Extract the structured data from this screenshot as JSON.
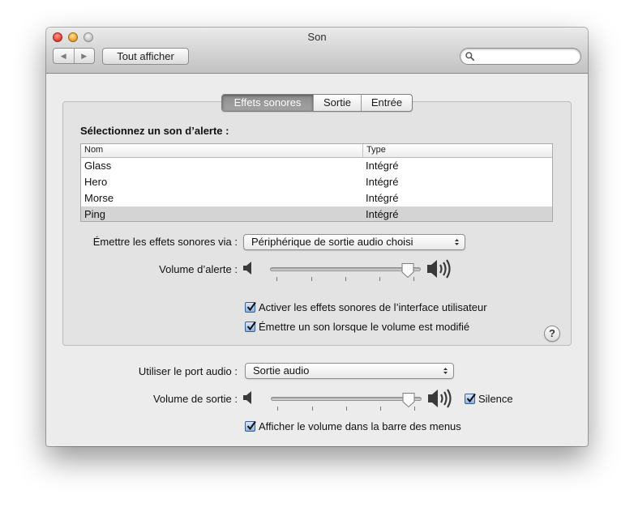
{
  "window": {
    "title": "Son"
  },
  "toolbar": {
    "back_label": "◀",
    "forward_label": "▶",
    "show_all_label": "Tout afficher",
    "search_value": "",
    "search_placeholder": ""
  },
  "tabs": [
    {
      "label": "Effets sonores",
      "selected": true
    },
    {
      "label": "Sortie",
      "selected": false
    },
    {
      "label": "Entrée",
      "selected": false
    }
  ],
  "alerts": {
    "heading": "Sélectionnez un son d’alerte :",
    "columns": [
      "Nom",
      "Type"
    ],
    "rows": [
      {
        "name": "Glass",
        "type": "Intégré",
        "selected": false
      },
      {
        "name": "Hero",
        "type": "Intégré",
        "selected": false
      },
      {
        "name": "Morse",
        "type": "Intégré",
        "selected": false
      },
      {
        "name": "Ping",
        "type": "Intégré",
        "selected": true
      }
    ]
  },
  "effects": {
    "play_via_label": "Émettre les effets sonores via :",
    "play_via_value": "Périphérique de sortie audio choisi",
    "alert_volume_label": "Volume d’alerte :",
    "alert_volume_level": 0.96,
    "ui_effects_label": "Activer les effets sonores de l’interface utilisateur",
    "ui_effects_checked": true,
    "volume_feedback_label": "Émettre un son lorsque le volume est modifié",
    "volume_feedback_checked": true,
    "help_label": "?"
  },
  "output": {
    "audio_port_label": "Utiliser le port audio :",
    "audio_port_value": "Sortie audio",
    "output_volume_label": "Volume de sortie :",
    "output_volume_level": 0.96,
    "mute_label": "Silence",
    "mute_checked": true,
    "show_volume_label": "Afficher le volume dans la barre des menus",
    "show_volume_checked": true
  },
  "colors": {
    "accent_checkbox": "#8cb3e2",
    "selected_tab": "#8d8d8d",
    "selected_row": "#d4d4d4",
    "window_bg": "#ececec"
  },
  "icons": [
    "back-arrow-icon",
    "forward-arrow-icon",
    "search-icon",
    "chevron-updown-icon",
    "speaker-low-icon",
    "speaker-high-icon",
    "checkmark-icon",
    "help-icon"
  ]
}
